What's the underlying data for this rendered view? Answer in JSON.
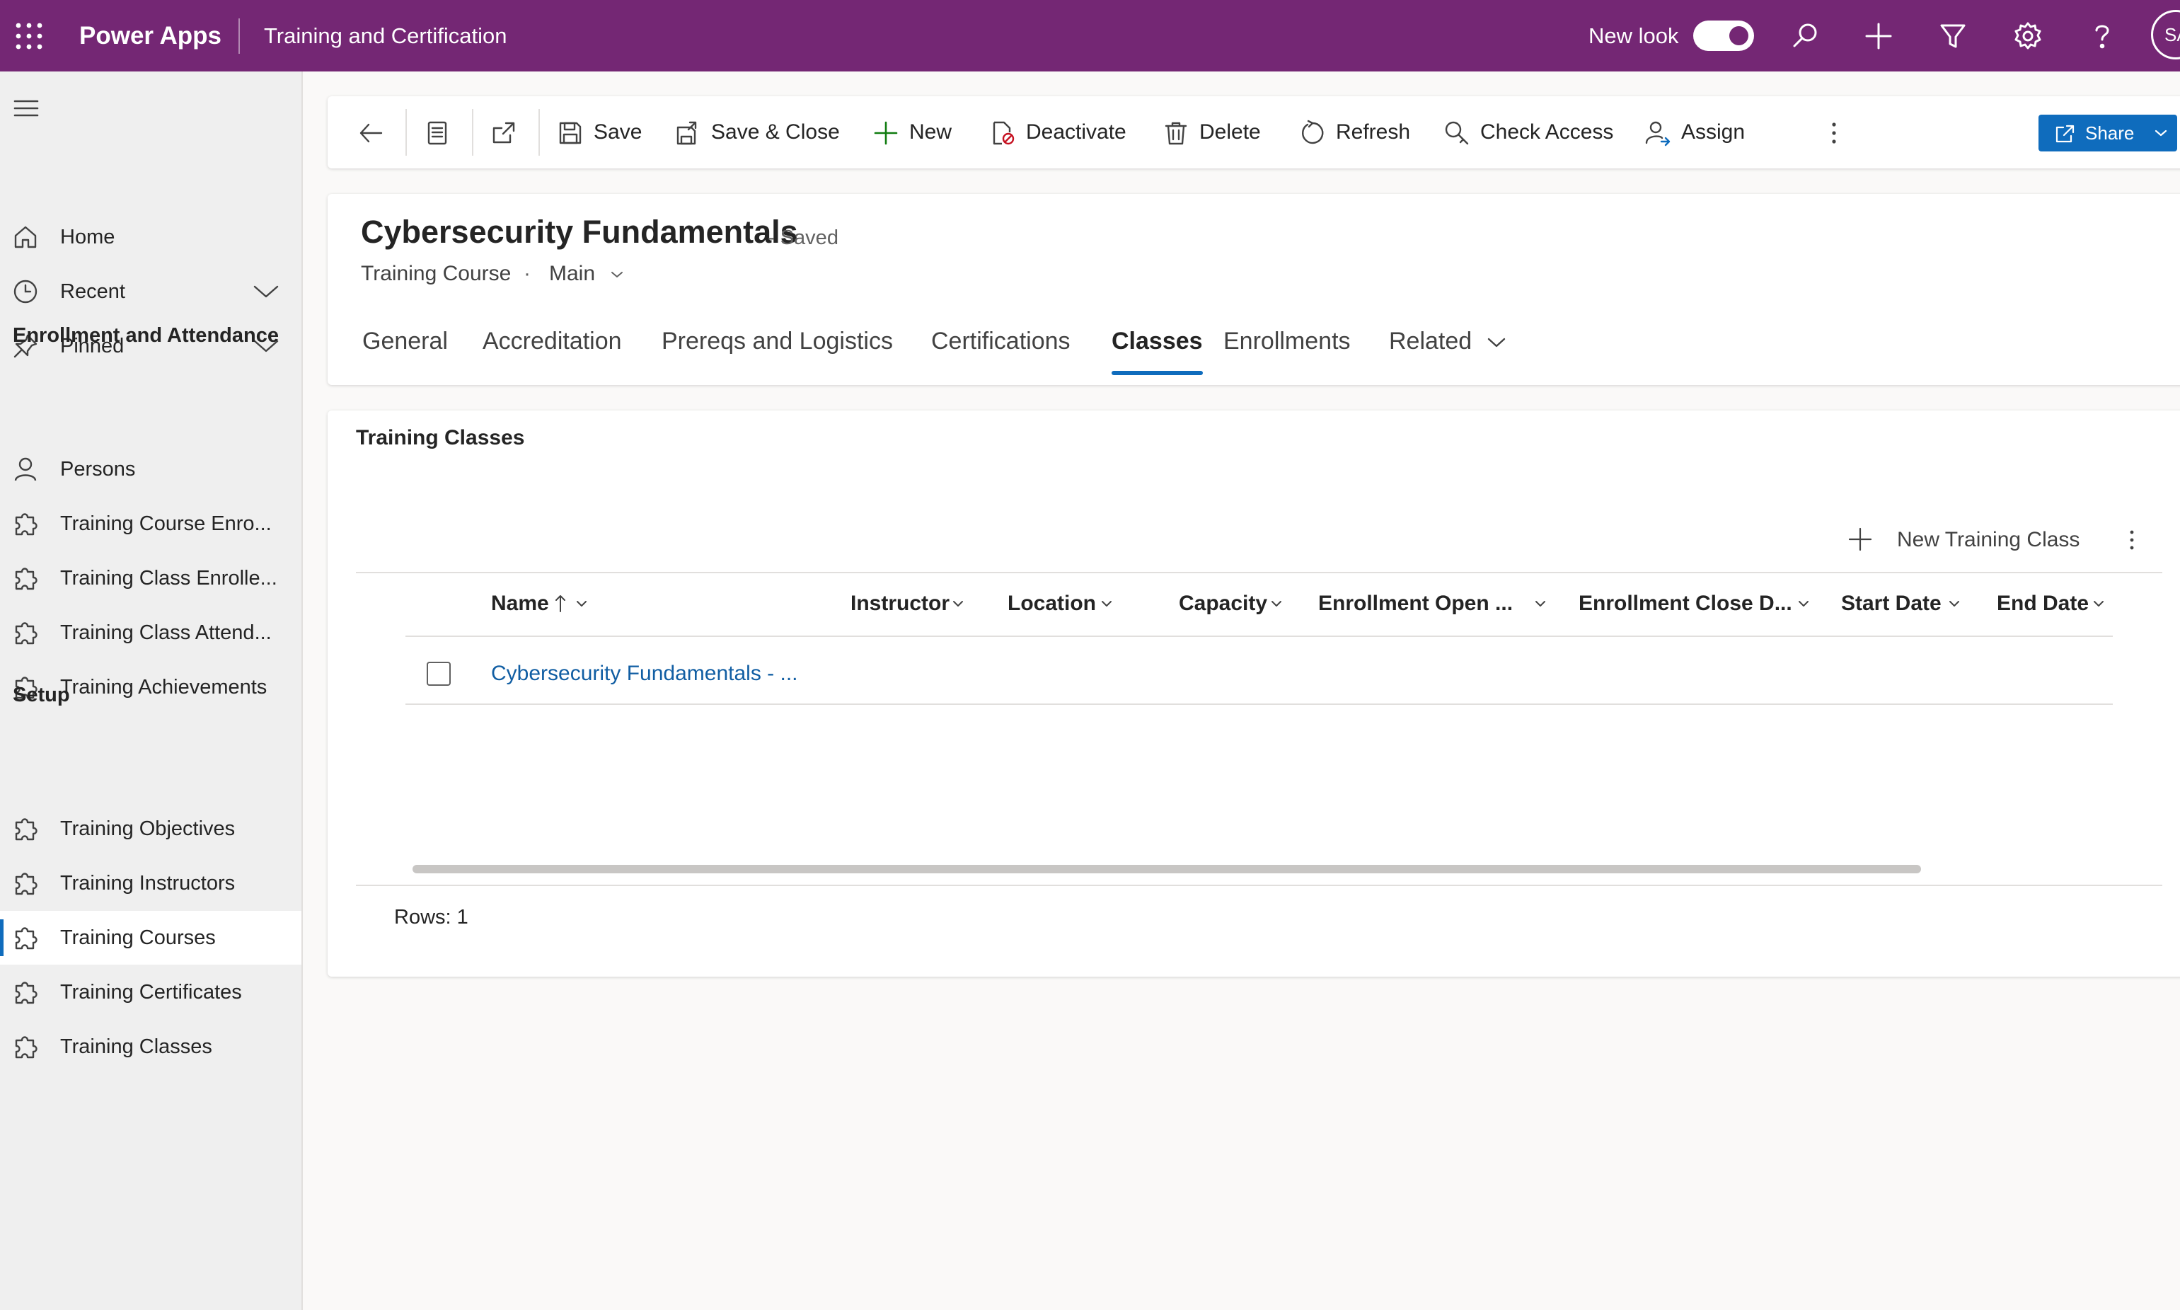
{
  "topbar": {
    "app_name": "Power Apps",
    "environment": "Training and Certification",
    "new_look_label": "New look",
    "new_look_enabled": true,
    "avatar_initials": "SA",
    "icons": [
      "waffle-icon",
      "search-icon",
      "add-icon",
      "filter-icon",
      "settings-icon",
      "help-icon"
    ],
    "brand_color": "#742774"
  },
  "sidebar": {
    "top_items": [
      {
        "label": "Home",
        "icon": "home-icon"
      },
      {
        "label": "Recent",
        "icon": "clock-icon",
        "expandable": true
      },
      {
        "label": "Pinned",
        "icon": "pin-icon",
        "expandable": true
      }
    ],
    "groups": [
      {
        "heading": "Enrollment and Attendance",
        "items": [
          {
            "label": "Persons",
            "icon": "person-icon"
          },
          {
            "label": "Training Course Enro...",
            "icon": "puzzle-icon"
          },
          {
            "label": "Training Class Enrolle...",
            "icon": "puzzle-icon"
          },
          {
            "label": "Training Class Attend...",
            "icon": "puzzle-icon"
          },
          {
            "label": "Training Achievements",
            "icon": "puzzle-icon"
          }
        ]
      },
      {
        "heading": "Setup",
        "items": [
          {
            "label": "Training Objectives",
            "icon": "puzzle-icon"
          },
          {
            "label": "Training Instructors",
            "icon": "puzzle-icon"
          },
          {
            "label": "Training Courses",
            "icon": "puzzle-icon",
            "active": true
          },
          {
            "label": "Training Certificates",
            "icon": "puzzle-icon"
          },
          {
            "label": "Training Classes",
            "icon": "puzzle-icon"
          }
        ]
      }
    ]
  },
  "commandbar": {
    "save": "Save",
    "save_close": "Save & Close",
    "new": "New",
    "deactivate": "Deactivate",
    "delete": "Delete",
    "refresh": "Refresh",
    "check_access": "Check Access",
    "assign": "Assign",
    "share": "Share",
    "accent_color": "#0f6cbd"
  },
  "record": {
    "title": "Cybersecurity Fundamentals",
    "status": "- Saved",
    "entity": "Training Course",
    "separator": "·",
    "form": "Main",
    "tabs": [
      {
        "label": "General"
      },
      {
        "label": "Accreditation"
      },
      {
        "label": "Prereqs and Logistics"
      },
      {
        "label": "Certifications"
      },
      {
        "label": "Classes",
        "active": true
      },
      {
        "label": "Enrollments"
      },
      {
        "label": "Related",
        "has_menu": true
      }
    ]
  },
  "section": {
    "title": "Training Classes",
    "new_button": "New Training Class",
    "columns": [
      {
        "label": "Name",
        "sorted": "ascending"
      },
      {
        "label": "Instructor"
      },
      {
        "label": "Location"
      },
      {
        "label": "Capacity"
      },
      {
        "label": "Enrollment Open ..."
      },
      {
        "label": "Enrollment Close D..."
      },
      {
        "label": "Start Date"
      },
      {
        "label": "End Date"
      }
    ],
    "rows": [
      {
        "name": "Cybersecurity Fundamentals - ..."
      }
    ],
    "rows_label": "Rows: 1",
    "link_color": "#115ea3"
  }
}
